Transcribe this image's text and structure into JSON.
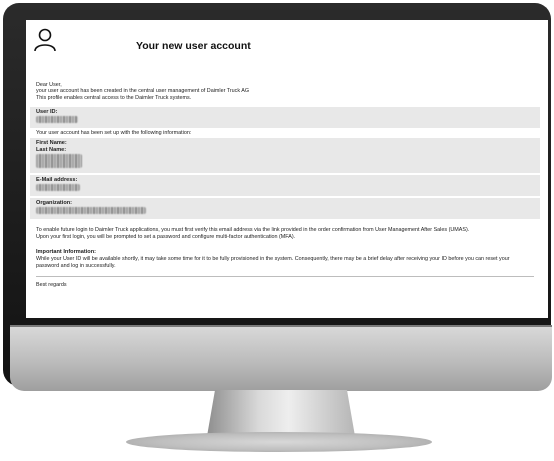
{
  "email": {
    "title": "Your new user account",
    "greeting": "Dear User,",
    "intro_line1": "your user account has been created in the central user management of Daimler Truck AG",
    "intro_line2": "This profile enables central access to the Daimler Truck systems.",
    "user_id_label": "User ID:",
    "setup_text": "Your user account has been set up with the following information:",
    "first_name_label": "First Name:",
    "last_name_label": "Last Name:",
    "email_label": "E-Mail address:",
    "organization_label": "Organization:",
    "login_text": "To enable future login to Daimler Truck applications, you must first verify this email address via the link provided in the order confirmation from User Management After Sales (UMAS).",
    "first_login_text": "Upon your first login, you will be prompted to set a password and configure multi-factor authentication (MFA).",
    "important_label": "Important Information:",
    "important_text": "While your User ID will be available shortly, it may take some time for it to be fully provisioned in the system. Consequently, there may be a brief delay after receiving your ID before you can reset your password and log in successfully.",
    "regards": "Best regards"
  },
  "colors": {
    "band": "#e8e8e8",
    "bezel": "#1a1a1a",
    "chin": "#c8c8c8"
  }
}
